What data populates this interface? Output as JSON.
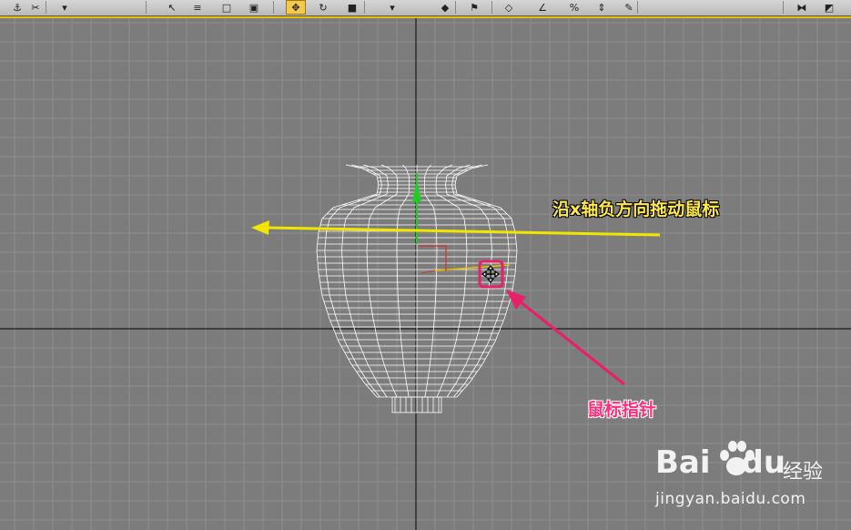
{
  "toolbar": {
    "buttons": [
      {
        "name": "select-link-icon",
        "glyph": "⚓"
      },
      {
        "name": "unlink-icon",
        "glyph": "✂"
      },
      {
        "name": "selection-filter-dropdown",
        "glyph": "▾"
      },
      {
        "name": "select-object-icon",
        "glyph": "↖"
      },
      {
        "name": "select-by-name-icon",
        "glyph": "≡"
      },
      {
        "name": "rect-selection-icon",
        "glyph": "□"
      },
      {
        "name": "window-crossing-icon",
        "glyph": "▣"
      },
      {
        "name": "select-move-icon",
        "glyph": "✥"
      },
      {
        "name": "select-rotate-icon",
        "glyph": "↻"
      },
      {
        "name": "select-scale-icon",
        "glyph": "■"
      },
      {
        "name": "reference-coord-dropdown",
        "glyph": "▾"
      },
      {
        "name": "pivot-center-icon",
        "glyph": "◆"
      },
      {
        "name": "select-manipulate-icon",
        "glyph": "⚑"
      },
      {
        "name": "snap-toggle-icon",
        "glyph": "◇"
      },
      {
        "name": "angle-snap-icon",
        "glyph": "∠"
      },
      {
        "name": "percent-snap-icon",
        "glyph": "%"
      },
      {
        "name": "spinner-snap-icon",
        "glyph": "⇕"
      },
      {
        "name": "edit-named-selection-icon",
        "glyph": "✎"
      },
      {
        "name": "mirror-icon",
        "glyph": "⧓"
      },
      {
        "name": "align-icon",
        "glyph": "◩"
      }
    ]
  },
  "annotations": {
    "drag_hint": "沿x轴负方向拖动鼠标",
    "cursor_label": "鼠标指针"
  },
  "watermark": {
    "brand": "Bai",
    "brand_suffix": "du",
    "brand_cn": "经验",
    "url": "jingyan.baidu.com"
  },
  "colors": {
    "viewport_bg": "#7c7c7c",
    "active_border": "#e6c000",
    "axis_arrow": "#f0e600",
    "pointer_arrow": "#e8206a",
    "wireframe": "#ffffff"
  }
}
